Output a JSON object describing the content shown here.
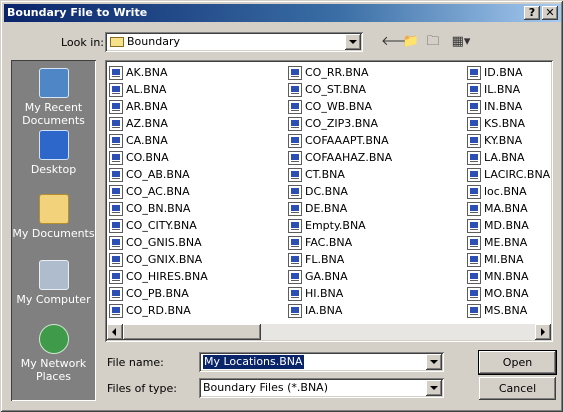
{
  "window": {
    "title": "Boundary File to Write",
    "help_label": "?",
    "close_label": "✕"
  },
  "lookin": {
    "label": "Look in:",
    "value": "Boundary"
  },
  "places": [
    {
      "label": "My Recent Documents",
      "icon": "recent-documents-icon"
    },
    {
      "label": "Desktop",
      "icon": "desktop-icon"
    },
    {
      "label": "My Documents",
      "icon": "my-documents-icon"
    },
    {
      "label": "My Computer",
      "icon": "my-computer-icon"
    },
    {
      "label": "My Network Places",
      "icon": "network-places-icon"
    }
  ],
  "files": {
    "col1": [
      "AK.BNA",
      "AL.BNA",
      "AR.BNA",
      "AZ.BNA",
      "CA.BNA",
      "CO.BNA",
      "CO_AB.BNA",
      "CO_AC.BNA",
      "CO_BN.BNA",
      "CO_CITY.BNA",
      "CO_GNIS.BNA",
      "CO_GNIX.BNA",
      "CO_HIRES.BNA",
      "CO_PB.BNA",
      "CO_RD.BNA"
    ],
    "col2": [
      "CO_RR.BNA",
      "CO_ST.BNA",
      "CO_WB.BNA",
      "CO_ZIP3.BNA",
      "COFAAAPT.BNA",
      "COFAAHAZ.BNA",
      "CT.BNA",
      "DC.BNA",
      "DE.BNA",
      "Empty.BNA",
      "FAC.BNA",
      "FL.BNA",
      "GA.BNA",
      "HI.BNA",
      "IA.BNA"
    ],
    "col3": [
      "ID.BNA",
      "IL.BNA",
      "IN.BNA",
      "KS.BNA",
      "KY.BNA",
      "LA.BNA",
      "LACIRC.BNA",
      "loc.BNA",
      "MA.BNA",
      "MD.BNA",
      "ME.BNA",
      "MI.BNA",
      "MN.BNA",
      "MO.BNA",
      "MS.BNA"
    ]
  },
  "filename": {
    "label": "File name:",
    "value": "My Locations.BNA"
  },
  "filetype": {
    "label": "Files of type:",
    "value": "Boundary Files (*.BNA)"
  },
  "buttons": {
    "open": "Open",
    "cancel": "Cancel"
  },
  "colors": {
    "titlebar": "#0a246a",
    "places_bg": "#808080",
    "selection": "#0a246a"
  }
}
